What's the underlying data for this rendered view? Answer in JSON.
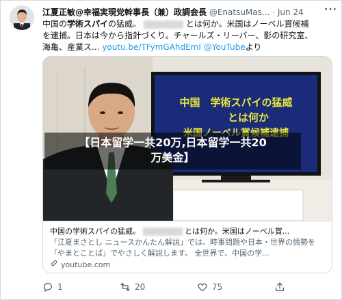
{
  "tweet": {
    "display_name": "江夏正敏@幸福実現党幹事長（兼）政調会長",
    "handle": "@EnatsuMas...",
    "separator": "·",
    "date": "Jun 24",
    "more_label": "···",
    "body_line1_prefix": "中国の",
    "body_line1_bold": "学術スパイ",
    "body_line1_mid": "の猛威。",
    "body_line1_suffix": "とは何か。米国はノーベル賞候補",
    "body_line2": "を逮捕。日本は今から指針づくり。チャールズ・リーバー、影の研究室、",
    "body_line3_prefix": "海亀、産業ス...",
    "body_link1": "youtu.be/TFymGAhdEmI",
    "body_link2": "@YouTube",
    "body_line3_suffix": "より"
  },
  "video": {
    "screen_lines": [
      "中国　学術スパイの猛威",
      "とは何か",
      "米国ノーベル賞候補逮捕"
    ]
  },
  "card": {
    "title_prefix": "中国の学術スパイの猛威。",
    "title_suffix": "とは何か。米国はノーベル賞...",
    "description": "「江夏まさとし ニュースかんたん解説」では、時事問題や日本・世界の情勢を「やまとことば」でやさしく解説します。 全世界で、中国の学...",
    "domain": "youtube.com"
  },
  "overlay": {
    "line1": "【日本留学一共20万,日本留学一共20",
    "line2": "万美金】"
  },
  "actions": {
    "reply_count": "1",
    "retweet_count": "20",
    "like_count": "75"
  },
  "icons": {
    "reply": "reply-icon",
    "retweet": "retweet-icon",
    "like": "heart-icon",
    "share": "share-icon",
    "link": "link-icon"
  },
  "colors": {
    "accent": "#1d9bf0",
    "text": "#0f1419",
    "muted": "#536471",
    "border": "#cfd9de"
  }
}
